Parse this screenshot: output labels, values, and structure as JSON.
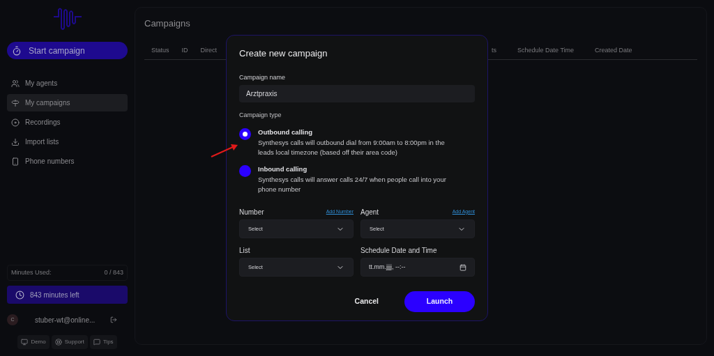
{
  "sidebar": {
    "start_button": "Start campaign",
    "items": [
      {
        "label": "My agents",
        "selected": false
      },
      {
        "label": "My campaigns",
        "selected": true
      },
      {
        "label": "Recordings",
        "selected": false
      },
      {
        "label": "Import lists",
        "selected": false
      },
      {
        "label": "Phone numbers",
        "selected": false
      }
    ],
    "minutes_used_label": "Minutes Used:",
    "minutes_used_value": "0 / 843",
    "minutes_left": "843 minutes left",
    "user": {
      "initial": "C",
      "email": "stuber-wt@online..."
    },
    "footer_buttons": [
      {
        "label": "Demo"
      },
      {
        "label": "Support"
      },
      {
        "label": "Tips"
      }
    ]
  },
  "main": {
    "title": "Campaigns",
    "columns_left": [
      "Status",
      "ID",
      "Direct"
    ],
    "columns_right": [
      "ts",
      "Schedule Date Time",
      "Created Date"
    ]
  },
  "dialog": {
    "title": "Create new campaign",
    "name_label": "Campaign name",
    "name_value": "Arztpraxis",
    "type_label": "Campaign type",
    "types": [
      {
        "title": "Outbound calling",
        "description": "Synthesys calls will outbound dial from 9:00am to 8:00pm in the leads local timezone (based off their area code)",
        "selected": true
      },
      {
        "title": "Inbound calling",
        "description": "Synthesys calls will answer calls 24/7 when people call into your phone number",
        "selected": false
      }
    ],
    "fields": [
      {
        "label": "Number",
        "link": "Add Number",
        "kind": "select",
        "value": "Select"
      },
      {
        "label": "Agent",
        "link": "Add Agent",
        "kind": "select",
        "value": "Select"
      },
      {
        "label": "List",
        "kind": "select",
        "value": "Select"
      },
      {
        "label": "Schedule Date and Time",
        "kind": "datetime",
        "value": "tt.mm.jjjj, --:--"
      }
    ],
    "cancel": "Cancel",
    "launch": "Launch"
  }
}
